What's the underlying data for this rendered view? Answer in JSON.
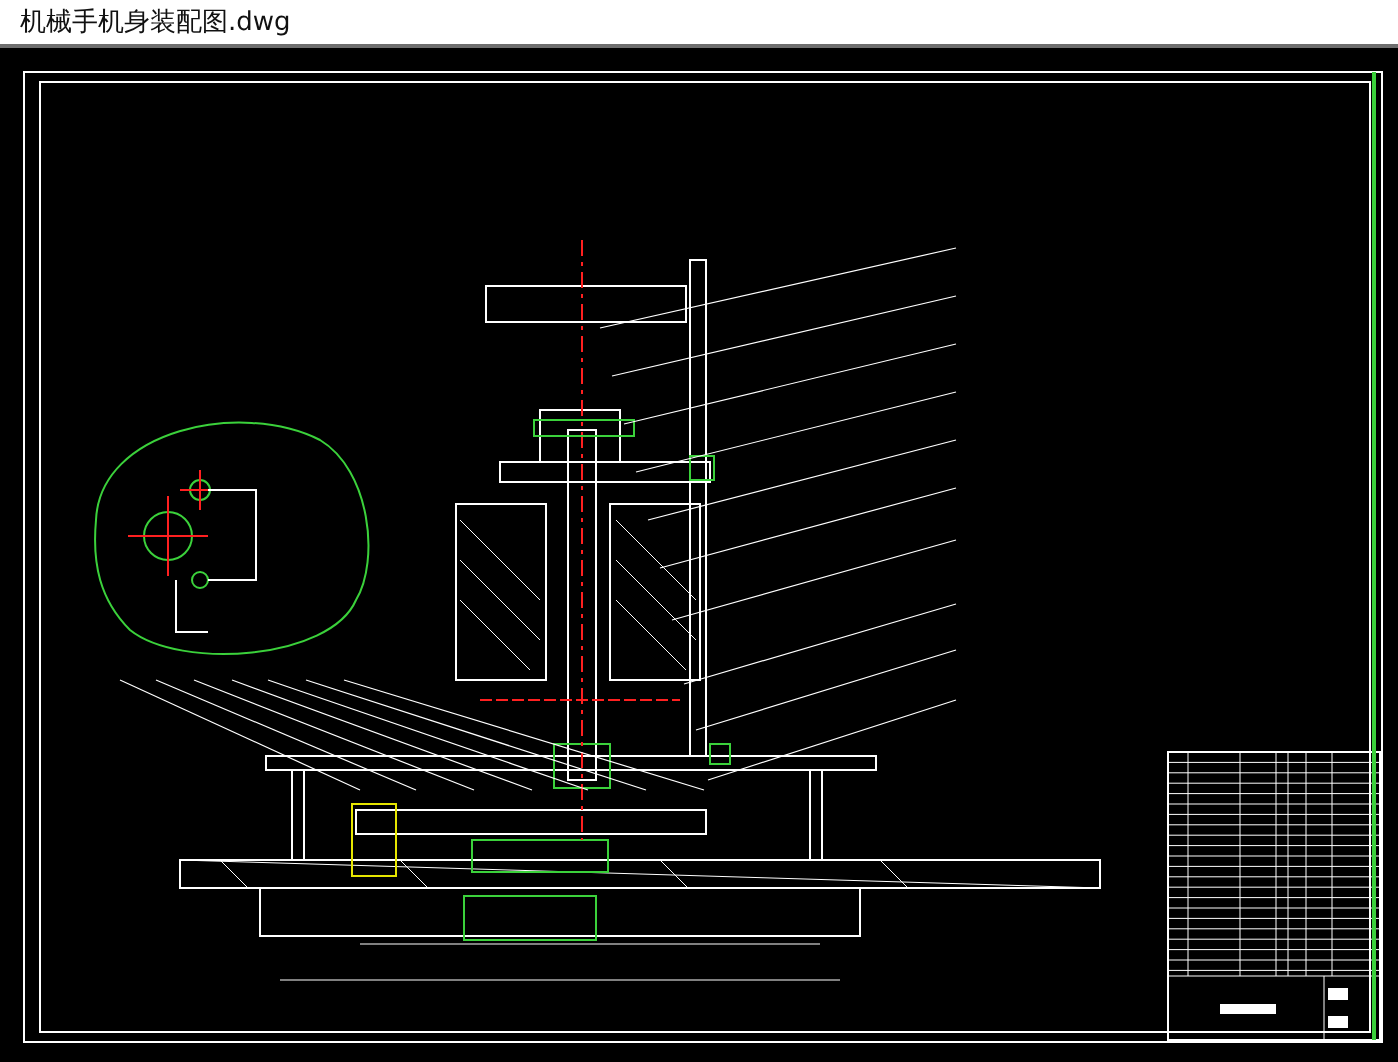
{
  "window": {
    "title": "机械手机身装配图.dwg"
  }
}
